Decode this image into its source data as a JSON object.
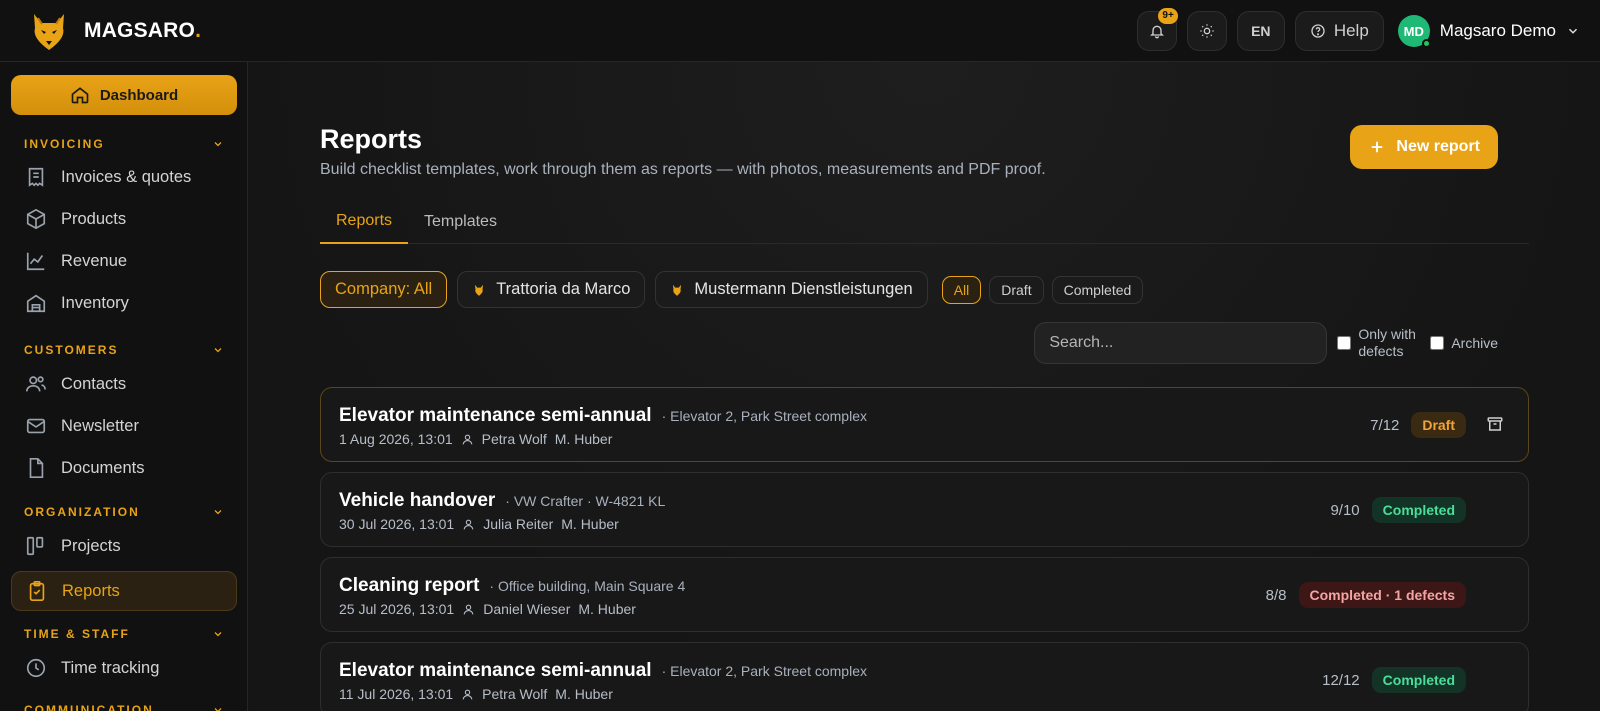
{
  "brand": {
    "name": "MAGSARO",
    "dot": "."
  },
  "topbar": {
    "notification_badge": "9+",
    "language": "EN",
    "help_label": "Help",
    "user_initials": "MD",
    "user_name": "Magsaro Demo"
  },
  "sidebar": {
    "dashboard_label": "Dashboard",
    "sections": {
      "invoicing": "INVOICING",
      "customers": "CUSTOMERS",
      "organization": "ORGANIZATION",
      "time_staff": "TIME & STAFF",
      "communication": "COMMUNICATION"
    },
    "items": {
      "invoices": "Invoices & quotes",
      "products": "Products",
      "revenue": "Revenue",
      "inventory": "Inventory",
      "contacts": "Contacts",
      "newsletter": "Newsletter",
      "documents": "Documents",
      "projects": "Projects",
      "reports": "Reports",
      "time_tracking": "Time tracking"
    }
  },
  "page": {
    "title": "Reports",
    "subtitle": "Build checklist templates, work through them as reports — with photos, measurements and PDF proof.",
    "new_button": "New report",
    "tabs": {
      "reports": "Reports",
      "templates": "Templates"
    },
    "filters": {
      "company_all": "Company: All",
      "company_1": "Trattoria da Marco",
      "company_2": "Mustermann Dienstleistungen",
      "status_all": "All",
      "status_draft": "Draft",
      "status_completed": "Completed"
    },
    "search": {
      "placeholder": "Search..."
    },
    "only_defects": "Only with defects",
    "archive": "Archive"
  },
  "reports": [
    {
      "title": "Elevator maintenance semi-annual",
      "subject": "· Elevator 2, Park Street complex",
      "date": "1 Aug 2026, 13:01",
      "person": "Petra Wolf",
      "assignee": "M. Huber",
      "count": "7/12",
      "status": "Draft"
    },
    {
      "title": "Vehicle handover",
      "subject": "· VW Crafter · W-4821 KL",
      "date": "30 Jul 2026, 13:01",
      "person": "Julia Reiter",
      "assignee": "M. Huber",
      "count": "9/10",
      "status": "Completed"
    },
    {
      "title": "Cleaning report",
      "subject": "· Office building, Main Square 4",
      "date": "25 Jul 2026, 13:01",
      "person": "Daniel Wieser",
      "assignee": "M. Huber",
      "count": "8/8",
      "status": "Completed · 1 defects"
    },
    {
      "title": "Elevator maintenance semi-annual",
      "subject": "· Elevator 2, Park Street complex",
      "date": "11 Jul 2026, 13:01",
      "person": "Petra Wolf",
      "assignee": "M. Huber",
      "count": "12/12",
      "status": "Completed"
    }
  ],
  "colors": {
    "accent": "#e8a317",
    "success": "#4ade9a",
    "danger": "#f5a3a3"
  }
}
